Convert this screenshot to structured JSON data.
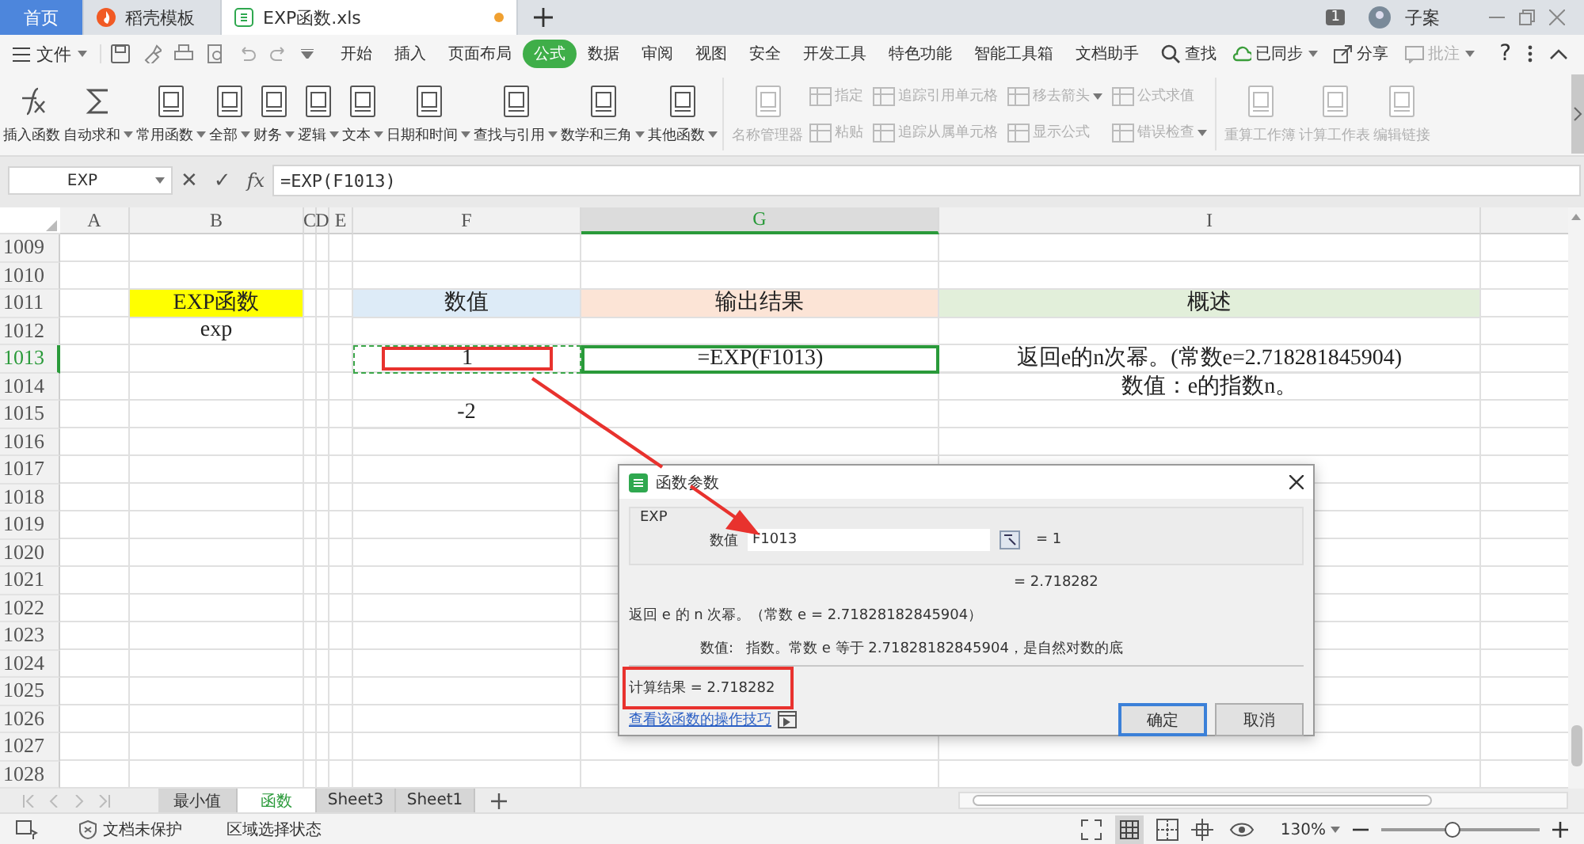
{
  "title_bar": {
    "tabs": [
      {
        "label": "首页",
        "kind": "home",
        "selected": false,
        "unsaved": false
      },
      {
        "label": "稻壳模板",
        "kind": "docer",
        "selected": false,
        "unsaved": false
      },
      {
        "label": "EXP函数.xls",
        "kind": "sheet",
        "selected": true,
        "unsaved": true
      }
    ],
    "badge": "1",
    "user": "子案"
  },
  "menu_bar": {
    "file": "文件",
    "items": [
      {
        "label": "开始",
        "selected": false
      },
      {
        "label": "插入",
        "selected": false
      },
      {
        "label": "页面布局",
        "selected": false
      },
      {
        "label": "公式",
        "selected": true
      },
      {
        "label": "数据",
        "selected": false
      },
      {
        "label": "审阅",
        "selected": false
      },
      {
        "label": "视图",
        "selected": false
      },
      {
        "label": "安全",
        "selected": false
      },
      {
        "label": "开发工具",
        "selected": false
      },
      {
        "label": "特色功能",
        "selected": false
      },
      {
        "label": "智能工具箱",
        "selected": false
      },
      {
        "label": "文档助手",
        "selected": false
      }
    ],
    "search": "查找",
    "right": [
      {
        "label": "已同步",
        "kind": "sync",
        "dropdown": true,
        "disabled": false
      },
      {
        "label": "分享",
        "kind": "share",
        "dropdown": false,
        "disabled": false
      },
      {
        "label": "批注",
        "kind": "comment",
        "dropdown": true,
        "disabled": true
      }
    ],
    "help": "?"
  },
  "ribbon": {
    "groups": [
      {
        "kind": "large",
        "items": [
          {
            "label": "插入函数",
            "dropdown": false,
            "disabled": false
          },
          {
            "label": "自动求和",
            "dropdown": true,
            "disabled": false
          },
          {
            "label": "常用函数",
            "dropdown": true,
            "disabled": false
          },
          {
            "label": "全部",
            "dropdown": true,
            "disabled": false
          },
          {
            "label": "财务",
            "dropdown": true,
            "disabled": false
          },
          {
            "label": "逻辑",
            "dropdown": true,
            "disabled": false
          },
          {
            "label": "文本",
            "dropdown": true,
            "disabled": false
          },
          {
            "label": "日期和时间",
            "dropdown": true,
            "disabled": false
          },
          {
            "label": "查找与引用",
            "dropdown": true,
            "disabled": false
          },
          {
            "label": "数学和三角",
            "dropdown": true,
            "disabled": false
          },
          {
            "label": "其他函数",
            "dropdown": true,
            "disabled": false
          }
        ]
      },
      {
        "kind": "large",
        "items": [
          {
            "label": "名称管理器",
            "dropdown": false,
            "disabled": true
          }
        ]
      },
      {
        "kind": "stack",
        "items": [
          {
            "label": "指定",
            "dropdown": false,
            "disabled": true
          },
          {
            "label": "粘贴",
            "dropdown": false,
            "disabled": true
          }
        ]
      },
      {
        "kind": "stack",
        "items": [
          {
            "label": "追踪引用单元格",
            "dropdown": false,
            "disabled": true
          },
          {
            "label": "追踪从属单元格",
            "dropdown": false,
            "disabled": true
          }
        ]
      },
      {
        "kind": "stack",
        "items": [
          {
            "label": "移去箭头",
            "dropdown": true,
            "disabled": true
          },
          {
            "label": "显示公式",
            "dropdown": false,
            "disabled": true
          }
        ]
      },
      {
        "kind": "stack",
        "items": [
          {
            "label": "公式求值",
            "dropdown": false,
            "disabled": true
          },
          {
            "label": "错误检查",
            "dropdown": true,
            "disabled": true
          }
        ]
      },
      {
        "kind": "large",
        "items": [
          {
            "label": "重算工作簿",
            "dropdown": false,
            "disabled": true
          },
          {
            "label": "计算工作表",
            "dropdown": false,
            "disabled": true
          }
        ]
      },
      {
        "kind": "large",
        "items": [
          {
            "label": "编辑链接",
            "dropdown": false,
            "disabled": true
          }
        ]
      }
    ]
  },
  "formula_bar": {
    "name_box": "EXP",
    "cancel": "✕",
    "enter": "✓",
    "fx": "fx",
    "value": "=EXP(F1013)"
  },
  "sheet": {
    "columns": [
      {
        "label": "A",
        "selected": false
      },
      {
        "label": "B",
        "selected": false
      },
      {
        "label": "C",
        "selected": false
      },
      {
        "label": "D",
        "selected": false
      },
      {
        "label": "E",
        "selected": false
      },
      {
        "label": "F",
        "selected": false
      },
      {
        "label": "G",
        "selected": true
      },
      {
        "label": "I",
        "selected": false
      }
    ],
    "rows": [
      {
        "number": "1009",
        "selected": false,
        "cells": {}
      },
      {
        "number": "1010",
        "selected": false,
        "cells": {}
      },
      {
        "number": "1011",
        "selected": false,
        "cells": {
          "B": {
            "text": "EXP函数",
            "color": "#ffff00"
          },
          "F": {
            "text": "数值",
            "color": "#ddebf7"
          },
          "G": {
            "text": "输出结果",
            "color": "#fce4d6"
          },
          "I": {
            "text": "概述",
            "color": "#e2efda"
          }
        }
      },
      {
        "number": "1012",
        "selected": false,
        "cells": {
          "B": {
            "text": "exp"
          }
        }
      },
      {
        "number": "1013",
        "selected": true,
        "cells": {
          "F": {
            "text": "1",
            "marquee": true,
            "highlighted": true
          },
          "G": {
            "text": "=EXP(F1013)",
            "active": true
          },
          "I": {
            "text": "返回e的n次幂。(常数e=2.718281845904)"
          }
        }
      },
      {
        "number": "1014",
        "selected": false,
        "cells": {
          "I": {
            "text": "数值：e的指数n。"
          }
        }
      },
      {
        "number": "1015",
        "selected": false,
        "cells": {
          "F": {
            "text": "-2"
          }
        }
      },
      {
        "number": "1016",
        "selected": false,
        "cells": {}
      },
      {
        "number": "1017",
        "selected": false,
        "cells": {}
      },
      {
        "number": "1018",
        "selected": false,
        "cells": {}
      },
      {
        "number": "1019",
        "selected": false,
        "cells": {}
      },
      {
        "number": "1020",
        "selected": false,
        "cells": {}
      },
      {
        "number": "1021",
        "selected": false,
        "cells": {}
      },
      {
        "number": "1022",
        "selected": false,
        "cells": {}
      },
      {
        "number": "1023",
        "selected": false,
        "cells": {}
      },
      {
        "number": "1024",
        "selected": false,
        "cells": {}
      },
      {
        "number": "1025",
        "selected": false,
        "cells": {}
      },
      {
        "number": "1026",
        "selected": false,
        "cells": {}
      },
      {
        "number": "1027",
        "selected": false,
        "cells": {}
      },
      {
        "number": "1028",
        "selected": false,
        "cells": {}
      }
    ]
  },
  "sheet_tabs": [
    {
      "label": "最小值",
      "selected": false
    },
    {
      "label": "函数",
      "selected": true
    },
    {
      "label": "Sheet3",
      "selected": false
    },
    {
      "label": "Sheet1",
      "selected": false
    }
  ],
  "status_bar": {
    "protection": "文档未保护",
    "selection_mode": "区域选择状态",
    "zoom": "130%",
    "zoom_slider": {
      "level": 0.45
    }
  },
  "dialog": {
    "title": "函数参数",
    "function": "EXP",
    "argument": {
      "label": "数值",
      "value": "F1013",
      "result": "= 1"
    },
    "result": "= 2.718282",
    "description": "返回 e 的 n 次幂。（常数 e = 2.71828182845904）",
    "argument_help_label": "数值:",
    "argument_help": "指数。常数 e 等于 2.71828182845904，是自然对数的底",
    "calc_result": {
      "text": "计算结果 =  2.718282",
      "highlighted": true
    },
    "link": "查看该函数的操作技巧",
    "buttons": [
      {
        "label": "确定",
        "kind": "default"
      },
      {
        "label": "取消",
        "kind": "normal"
      }
    ]
  }
}
